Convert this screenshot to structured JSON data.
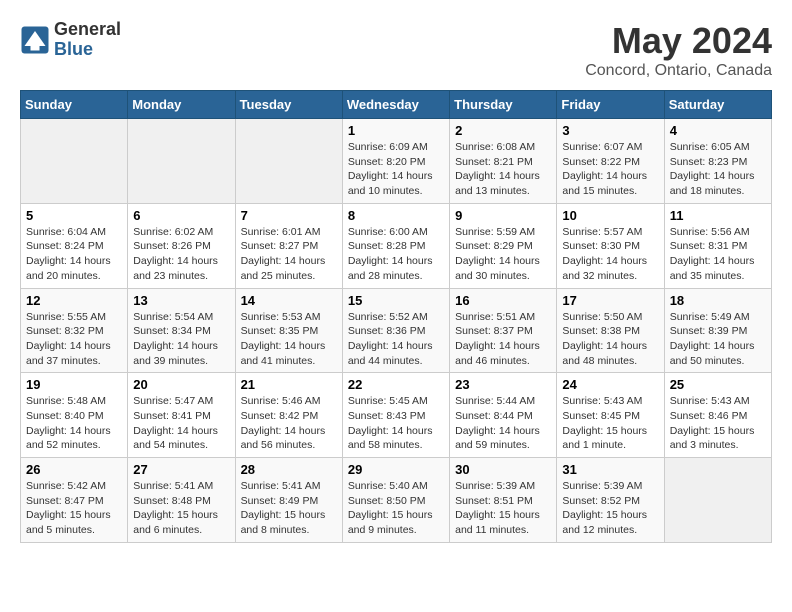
{
  "header": {
    "logo_general": "General",
    "logo_blue": "Blue",
    "month_title": "May 2024",
    "location": "Concord, Ontario, Canada"
  },
  "days_of_week": [
    "Sunday",
    "Monday",
    "Tuesday",
    "Wednesday",
    "Thursday",
    "Friday",
    "Saturday"
  ],
  "weeks": [
    [
      {
        "day": "",
        "info": ""
      },
      {
        "day": "",
        "info": ""
      },
      {
        "day": "",
        "info": ""
      },
      {
        "day": "1",
        "info": "Sunrise: 6:09 AM\nSunset: 8:20 PM\nDaylight: 14 hours\nand 10 minutes."
      },
      {
        "day": "2",
        "info": "Sunrise: 6:08 AM\nSunset: 8:21 PM\nDaylight: 14 hours\nand 13 minutes."
      },
      {
        "day": "3",
        "info": "Sunrise: 6:07 AM\nSunset: 8:22 PM\nDaylight: 14 hours\nand 15 minutes."
      },
      {
        "day": "4",
        "info": "Sunrise: 6:05 AM\nSunset: 8:23 PM\nDaylight: 14 hours\nand 18 minutes."
      }
    ],
    [
      {
        "day": "5",
        "info": "Sunrise: 6:04 AM\nSunset: 8:24 PM\nDaylight: 14 hours\nand 20 minutes."
      },
      {
        "day": "6",
        "info": "Sunrise: 6:02 AM\nSunset: 8:26 PM\nDaylight: 14 hours\nand 23 minutes."
      },
      {
        "day": "7",
        "info": "Sunrise: 6:01 AM\nSunset: 8:27 PM\nDaylight: 14 hours\nand 25 minutes."
      },
      {
        "day": "8",
        "info": "Sunrise: 6:00 AM\nSunset: 8:28 PM\nDaylight: 14 hours\nand 28 minutes."
      },
      {
        "day": "9",
        "info": "Sunrise: 5:59 AM\nSunset: 8:29 PM\nDaylight: 14 hours\nand 30 minutes."
      },
      {
        "day": "10",
        "info": "Sunrise: 5:57 AM\nSunset: 8:30 PM\nDaylight: 14 hours\nand 32 minutes."
      },
      {
        "day": "11",
        "info": "Sunrise: 5:56 AM\nSunset: 8:31 PM\nDaylight: 14 hours\nand 35 minutes."
      }
    ],
    [
      {
        "day": "12",
        "info": "Sunrise: 5:55 AM\nSunset: 8:32 PM\nDaylight: 14 hours\nand 37 minutes."
      },
      {
        "day": "13",
        "info": "Sunrise: 5:54 AM\nSunset: 8:34 PM\nDaylight: 14 hours\nand 39 minutes."
      },
      {
        "day": "14",
        "info": "Sunrise: 5:53 AM\nSunset: 8:35 PM\nDaylight: 14 hours\nand 41 minutes."
      },
      {
        "day": "15",
        "info": "Sunrise: 5:52 AM\nSunset: 8:36 PM\nDaylight: 14 hours\nand 44 minutes."
      },
      {
        "day": "16",
        "info": "Sunrise: 5:51 AM\nSunset: 8:37 PM\nDaylight: 14 hours\nand 46 minutes."
      },
      {
        "day": "17",
        "info": "Sunrise: 5:50 AM\nSunset: 8:38 PM\nDaylight: 14 hours\nand 48 minutes."
      },
      {
        "day": "18",
        "info": "Sunrise: 5:49 AM\nSunset: 8:39 PM\nDaylight: 14 hours\nand 50 minutes."
      }
    ],
    [
      {
        "day": "19",
        "info": "Sunrise: 5:48 AM\nSunset: 8:40 PM\nDaylight: 14 hours\nand 52 minutes."
      },
      {
        "day": "20",
        "info": "Sunrise: 5:47 AM\nSunset: 8:41 PM\nDaylight: 14 hours\nand 54 minutes."
      },
      {
        "day": "21",
        "info": "Sunrise: 5:46 AM\nSunset: 8:42 PM\nDaylight: 14 hours\nand 56 minutes."
      },
      {
        "day": "22",
        "info": "Sunrise: 5:45 AM\nSunset: 8:43 PM\nDaylight: 14 hours\nand 58 minutes."
      },
      {
        "day": "23",
        "info": "Sunrise: 5:44 AM\nSunset: 8:44 PM\nDaylight: 14 hours\nand 59 minutes."
      },
      {
        "day": "24",
        "info": "Sunrise: 5:43 AM\nSunset: 8:45 PM\nDaylight: 15 hours\nand 1 minute."
      },
      {
        "day": "25",
        "info": "Sunrise: 5:43 AM\nSunset: 8:46 PM\nDaylight: 15 hours\nand 3 minutes."
      }
    ],
    [
      {
        "day": "26",
        "info": "Sunrise: 5:42 AM\nSunset: 8:47 PM\nDaylight: 15 hours\nand 5 minutes."
      },
      {
        "day": "27",
        "info": "Sunrise: 5:41 AM\nSunset: 8:48 PM\nDaylight: 15 hours\nand 6 minutes."
      },
      {
        "day": "28",
        "info": "Sunrise: 5:41 AM\nSunset: 8:49 PM\nDaylight: 15 hours\nand 8 minutes."
      },
      {
        "day": "29",
        "info": "Sunrise: 5:40 AM\nSunset: 8:50 PM\nDaylight: 15 hours\nand 9 minutes."
      },
      {
        "day": "30",
        "info": "Sunrise: 5:39 AM\nSunset: 8:51 PM\nDaylight: 15 hours\nand 11 minutes."
      },
      {
        "day": "31",
        "info": "Sunrise: 5:39 AM\nSunset: 8:52 PM\nDaylight: 15 hours\nand 12 minutes."
      },
      {
        "day": "",
        "info": ""
      }
    ]
  ]
}
